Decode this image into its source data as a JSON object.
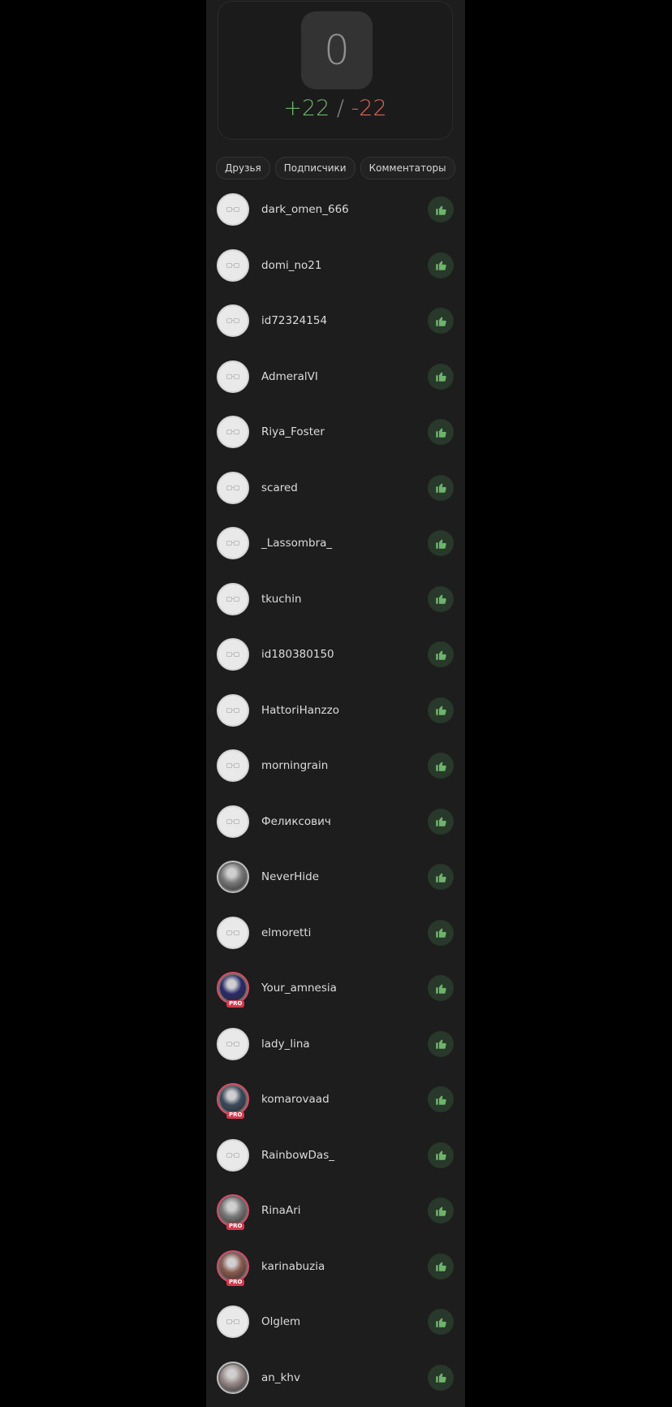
{
  "score": {
    "total": "0",
    "plus": "+22",
    "separator": " / ",
    "minus": "-22"
  },
  "tabs": [
    "Друзья",
    "Подписчики",
    "Комментаторы"
  ],
  "icons": {
    "like": "thumbs-up-icon",
    "avatar_placeholder": "glasses-icon"
  },
  "colors": {
    "plus": "#6db46b",
    "minus": "#d9675a",
    "like_bg": "#28382a",
    "like_icon": "#6db46b",
    "pro_badge": "#d33a4d"
  },
  "voters": [
    {
      "name": "dark_omen_666",
      "avatar": "default"
    },
    {
      "name": "domi_no21",
      "avatar": "default"
    },
    {
      "name": "id72324154",
      "avatar": "default"
    },
    {
      "name": "AdmeralVI",
      "avatar": "default"
    },
    {
      "name": "Riya_Foster",
      "avatar": "default"
    },
    {
      "name": "scared",
      "avatar": "default"
    },
    {
      "name": "_Lassombra_",
      "avatar": "default"
    },
    {
      "name": "tkuchin",
      "avatar": "default"
    },
    {
      "name": "id180380150",
      "avatar": "default"
    },
    {
      "name": "HattoriHanzzo",
      "avatar": "default"
    },
    {
      "name": "morningrain",
      "avatar": "default"
    },
    {
      "name": "Феликсович",
      "avatar": "default"
    },
    {
      "name": "NeverHide",
      "avatar": "photo"
    },
    {
      "name": "elmoretti",
      "avatar": "default"
    },
    {
      "name": "Your_amnesia",
      "avatar": "photo",
      "badge": "PRO"
    },
    {
      "name": "lady_lina",
      "avatar": "default"
    },
    {
      "name": "komarovaad",
      "avatar": "photo",
      "badge": "PRO"
    },
    {
      "name": "RainbowDas_",
      "avatar": "default"
    },
    {
      "name": "RinaAri",
      "avatar": "photo",
      "badge": "PRO"
    },
    {
      "name": "karinabuzia",
      "avatar": "photo",
      "badge": "PRO"
    },
    {
      "name": "Olglem",
      "avatar": "default"
    },
    {
      "name": "an_khv",
      "avatar": "photo"
    }
  ]
}
